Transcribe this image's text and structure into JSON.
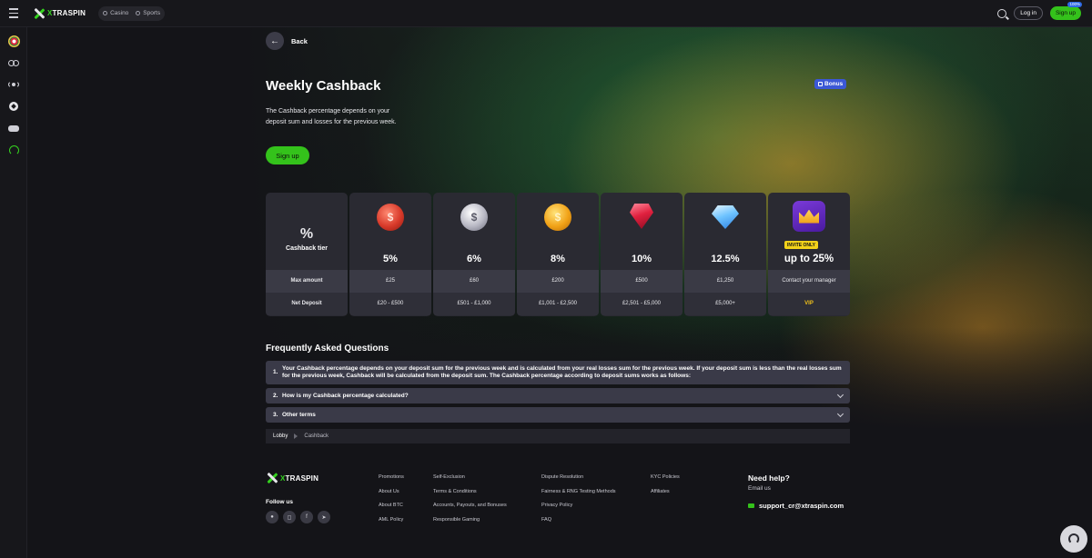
{
  "header": {
    "logo_prefix": "X",
    "logo_rest": "TRASPIN",
    "modes": [
      "Casino",
      "Sports"
    ],
    "login_label": "Log in",
    "signup_label": "Sign up",
    "signup_badge": "100%"
  },
  "sidebar": {
    "items": [
      "roulette-wheel-icon",
      "cycling-icon",
      "live-broadcast-icon",
      "football-icon",
      "gamepad-icon",
      "support-headset-icon"
    ]
  },
  "page": {
    "back_label": "Back",
    "title": "Weekly Cashback",
    "bonus_tag": "Bonus",
    "description": "The Cashback percentage depends on your deposit sum and losses for the previous week.",
    "signup_label": "Sign up"
  },
  "tiers": {
    "header_label": "Cashback tier",
    "percent_symbol": "%",
    "row_labels": [
      "Max amount",
      "Net Deposit"
    ],
    "columns": [
      {
        "icon": "red-coin-icon",
        "percent": "5%",
        "max_amount": "£25",
        "net_deposit": "£20 - £500"
      },
      {
        "icon": "silver-coin-icon",
        "percent": "6%",
        "max_amount": "£60",
        "net_deposit": "£501 - £1,000"
      },
      {
        "icon": "gold-coin-icon",
        "percent": "8%",
        "max_amount": "£200",
        "net_deposit": "£1,001 - £2,500"
      },
      {
        "icon": "ruby-gem-icon",
        "percent": "10%",
        "max_amount": "£500",
        "net_deposit": "£2,501 - £5,000"
      },
      {
        "icon": "diamond-icon",
        "percent": "12.5%",
        "max_amount": "£1,250",
        "net_deposit": "£5,000+"
      },
      {
        "icon": "crown-icon",
        "badge": "INVITE ONLY",
        "percent": "up to 25%",
        "max_amount": "Contact your manager",
        "net_deposit": "VIP"
      }
    ]
  },
  "faq": {
    "title": "Frequently Asked Questions",
    "items": [
      {
        "num": "1.",
        "text": "Your Cashback percentage depends on your deposit sum for the previous week and is calculated from your real losses sum for the previous week. If your deposit sum is less than the real losses sum for the previous week, Cashback will be calculated from the deposit sum. The Cashback percentage according to deposit sums works as follows:",
        "expanded": true
      },
      {
        "num": "2.",
        "text": "How is my Cashback percentage calculated?",
        "expanded": false
      },
      {
        "num": "3.",
        "text": "Other terms",
        "expanded": false
      }
    ]
  },
  "breadcrumb": [
    "Lobby",
    "Cashback"
  ],
  "footer": {
    "follow_label": "Follow us",
    "socials": [
      "globe-icon",
      "instagram-icon",
      "facebook-icon",
      "telegram-icon"
    ],
    "columns": [
      [
        "Promotions",
        "About Us",
        "About BTC",
        "AML Policy"
      ],
      [
        "Self-Exclusion",
        "Terms & Conditions",
        "Accounts, Payouts, and Bonuses",
        "Responsible Gaming"
      ],
      [
        "Dispute Resolution",
        "Fairness & RNG Testing Methods",
        "Privacy Policy",
        "FAQ"
      ],
      [
        "KYC Policies",
        "Affiliates"
      ]
    ],
    "help_title": "Need help?",
    "help_sub": "Email us",
    "email": "support_cr@xtraspin.com"
  },
  "colors": {
    "accent_green": "#34c21b",
    "bonus_blue": "#3b58d6",
    "vip_gold": "#f2c21a",
    "background": "#141418"
  }
}
